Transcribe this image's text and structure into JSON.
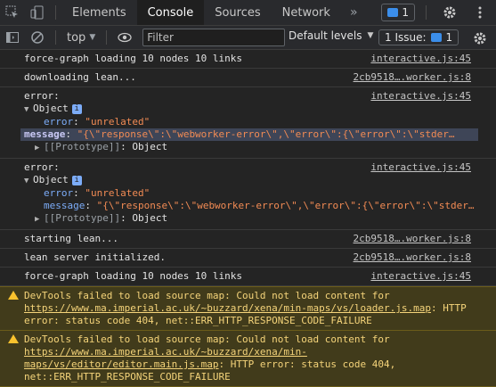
{
  "tabs": {
    "items": [
      "Elements",
      "Console",
      "Sources",
      "Network"
    ],
    "more": "»",
    "messages_count": "1"
  },
  "toolbar": {
    "context": "top",
    "filter_placeholder": "Filter",
    "levels": "Default levels",
    "issues_label": "1 Issue:",
    "issues_count": "1"
  },
  "log": {
    "row1": {
      "text": "force-graph loading 10 nodes 10 links",
      "src": "interactive.js:45"
    },
    "row2": {
      "text": "downloading lean...",
      "src": "2cb9518….worker.js:8"
    },
    "row3": {
      "text": "error:",
      "src": "interactive.js:45",
      "obj": "Object",
      "err_key": "error",
      "err_val": "\"unrelated\"",
      "msg_key": "message",
      "msg_val": "\"{\\\"response\\\":\\\"webworker-error\\\",\\\"error\\\":{\\\"error\\\":\\\"stder…",
      "proto": "[[Prototype]]",
      "proto_val": "Object"
    },
    "row4": {
      "text": "error:",
      "src": "interactive.js:45",
      "obj": "Object",
      "err_key": "error",
      "err_val": "\"unrelated\"",
      "msg_key": "message",
      "msg_val": "\"{\\\"response\\\":\\\"webworker-error\\\",\\\"error\\\":{\\\"error\\\":\\\"stder…",
      "proto": "[[Prototype]]",
      "proto_val": "Object"
    },
    "row5": {
      "text": "starting lean...",
      "src": "2cb9518….worker.js:8"
    },
    "row6": {
      "text": "lean server initialized.",
      "src": "2cb9518….worker.js:8"
    },
    "row7": {
      "text": "force-graph loading 10 nodes 10 links",
      "src": "interactive.js:45"
    },
    "warn1": {
      "pre": "DevTools failed to load source map: Could not load content for ",
      "link": "https://www.ma.imperial.ac.uk/~buzzard/xena/min-maps/vs/loader.js.map",
      "post": ": HTTP error: status code 404, net::ERR_HTTP_RESPONSE_CODE_FAILURE"
    },
    "warn2": {
      "pre": "DevTools failed to load source map: Could not load content for ",
      "link": "https://www.ma.imperial.ac.uk/~buzzard/xena/min-maps/vs/editor/editor.main.js.map",
      "post": ": HTTP error: status code 404, net::ERR_HTTP_RESPONSE_CODE_FAILURE"
    }
  },
  "colors": {
    "warning": "#f5d47a",
    "accent": "#3b8eea",
    "key": "#7cacf8",
    "string": "#f28b54"
  }
}
